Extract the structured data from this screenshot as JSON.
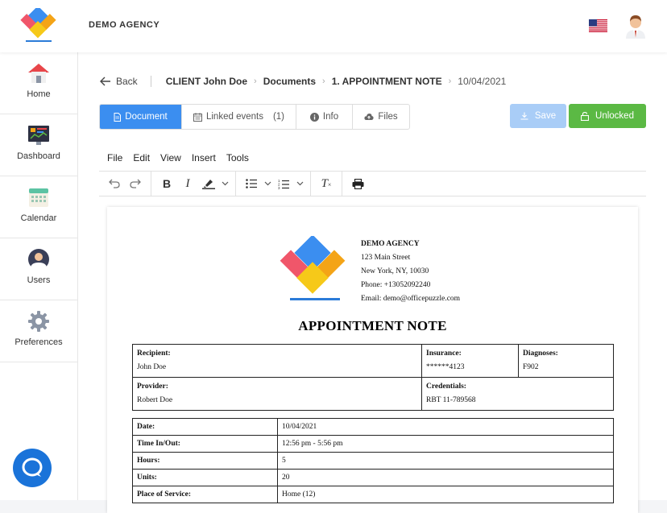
{
  "header": {
    "brand": "DEMO AGENCY"
  },
  "sidebar": {
    "items": [
      {
        "label": "Home",
        "icon": "home-icon"
      },
      {
        "label": "Dashboard",
        "icon": "dashboard-icon"
      },
      {
        "label": "Calendar",
        "icon": "calendar-icon"
      },
      {
        "label": "Users",
        "icon": "users-icon"
      },
      {
        "label": "Preferences",
        "icon": "gear-icon"
      }
    ]
  },
  "breadcrumb": {
    "back": "Back",
    "client": "CLIENT John Doe",
    "documents": "Documents",
    "note": "1. APPOINTMENT NOTE",
    "date": "10/04/2021"
  },
  "tabs": [
    {
      "label": "Document"
    },
    {
      "label": "Linked events",
      "count": "(1)"
    },
    {
      "label": "Info"
    },
    {
      "label": "Files"
    }
  ],
  "actions": {
    "save": "Save",
    "unlocked": "Unlocked"
  },
  "menubar": [
    "File",
    "Edit",
    "View",
    "Insert",
    "Tools"
  ],
  "colors": {
    "primary": "#3b8ef0",
    "success": "#5bb944",
    "save_disabled": "#a9cdf7",
    "chat": "#1a73d9"
  },
  "document": {
    "org": {
      "name": "DEMO AGENCY",
      "address1": "123 Main Street",
      "address2": "New York, NY, 10030",
      "phone": "Phone: +13052092240",
      "email": "Email: demo@officepuzzle.com"
    },
    "title": "APPOINTMENT NOTE",
    "info": {
      "recipient_label": "Recipient:",
      "recipient": "John Doe",
      "insurance_label": "Insurance:",
      "insurance": "******4123",
      "diagnoses_label": "Diagnoses:",
      "diagnoses": "F902",
      "provider_label": "Provider:",
      "provider": "Robert Doe",
      "credentials_label": "Credentials:",
      "credentials": "RBT 11-789568"
    },
    "details": [
      {
        "label": "Date:",
        "value": "10/04/2021"
      },
      {
        "label": "Time In/Out:",
        "value": "12:56 pm - 5:56 pm"
      },
      {
        "label": "Hours:",
        "value": "5"
      },
      {
        "label": "Units:",
        "value": "20"
      },
      {
        "label": "Place of Service:",
        "value": "Home (12)"
      }
    ]
  }
}
